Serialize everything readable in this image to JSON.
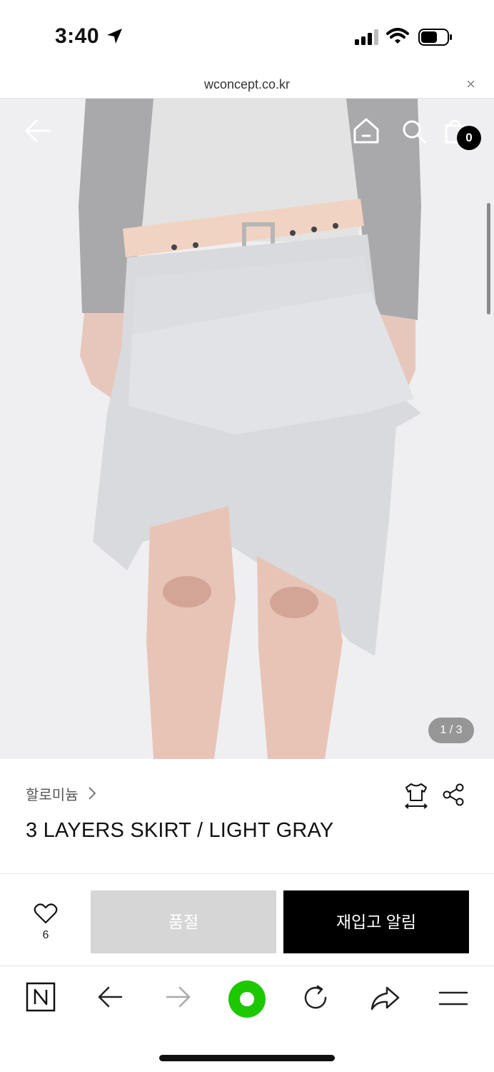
{
  "status_bar": {
    "time": "3:40"
  },
  "url_bar": {
    "url": "wconcept.co.kr",
    "close_label": "×"
  },
  "product_nav": {
    "cart_count": "0"
  },
  "gallery": {
    "counter": "1 / 3"
  },
  "product": {
    "brand": "할로미늄",
    "title": "3 LAYERS SKIRT / LIGHT GRAY"
  },
  "purchase": {
    "like_count": "6",
    "soldout_label": "품절",
    "restock_label": "재입고 알림"
  },
  "toolbar": {
    "naver_label": "N",
    "accent_color": "#1ec800"
  }
}
